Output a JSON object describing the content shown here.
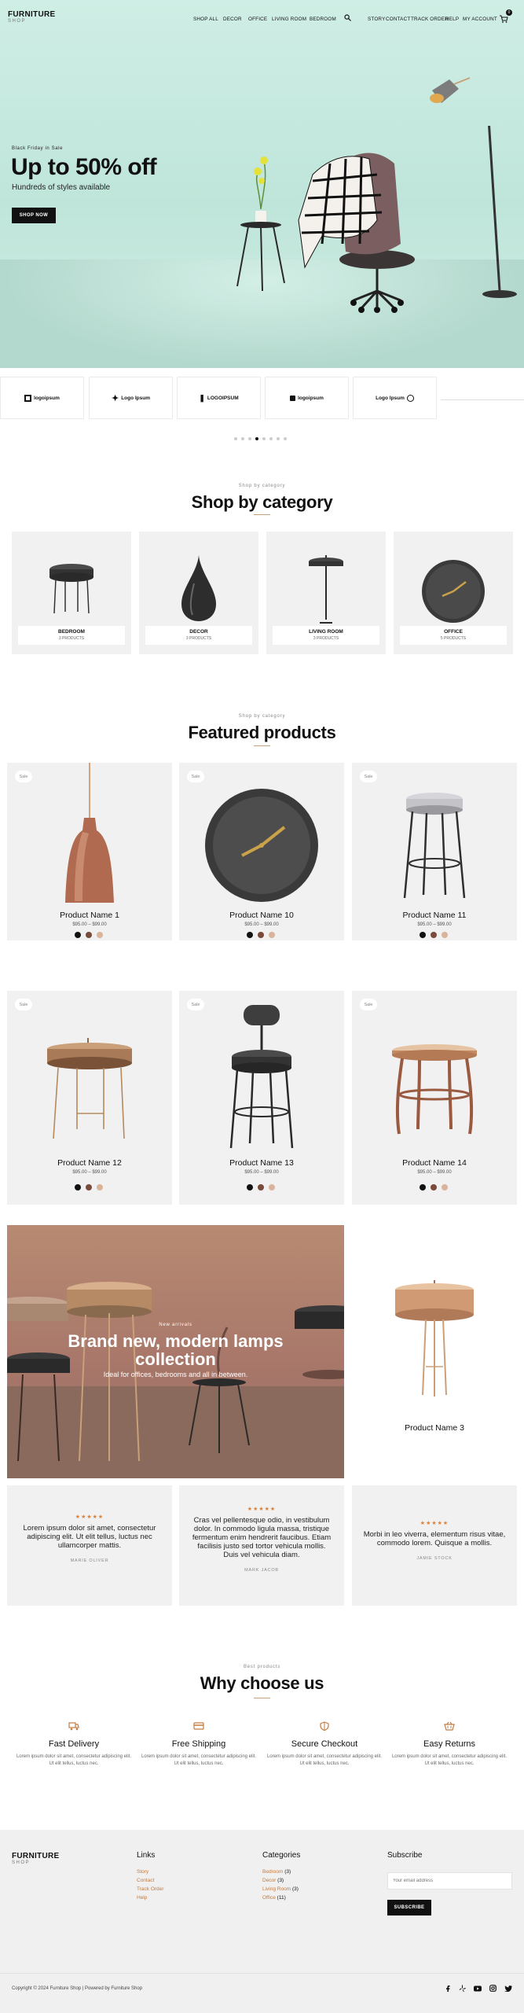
{
  "brand": {
    "name": "FURNITURE",
    "sub": "SHOP"
  },
  "nav": {
    "items": [
      "SHOP ALL",
      "DECOR",
      "OFFICE",
      "LIVING ROOM",
      "BEDROOM"
    ],
    "right_items": [
      "STORY",
      "CONTACT",
      "TRACK ORDER",
      "HELP",
      "MY ACCOUNT"
    ],
    "cart_count": "0"
  },
  "hero": {
    "eyebrow": "Black Friday in Sale",
    "title": "Up to 50% off",
    "subtitle": "Hundreds of styles available",
    "cta": "SHOP NOW"
  },
  "brands": [
    "logoipsum",
    "Logo Ipsum",
    "LOGOIPSUM",
    "logoipsum",
    "Logo Ipsum"
  ],
  "carousel": {
    "dots": 8,
    "active": 3
  },
  "categories": {
    "eyebrow": "Shop by category",
    "title": "Shop by category",
    "items": [
      {
        "name": "BEDROOM",
        "count": "3 PRODUCTS"
      },
      {
        "name": "DECOR",
        "count": "3 PRODUCTS"
      },
      {
        "name": "LIVING ROOM",
        "count": "3 PRODUCTS"
      },
      {
        "name": "OFFICE",
        "count": "5 PRODUCTS"
      }
    ]
  },
  "featured": {
    "eyebrow": "Shop by category",
    "title": "Featured products",
    "sale_label": "Sale",
    "price": "$95.00 – $99.00",
    "products": [
      {
        "name": "Product Name 1"
      },
      {
        "name": "Product Name 10"
      },
      {
        "name": "Product Name 11"
      },
      {
        "name": "Product Name 12"
      },
      {
        "name": "Product Name 13"
      },
      {
        "name": "Product Name 14"
      }
    ],
    "swatches": [
      "#111111",
      "#7a4a3a",
      "#d9b49a"
    ]
  },
  "promo": {
    "eyebrow": "New arrivals",
    "title_line1": "Brand new, modern lamps",
    "title_line2": "collection",
    "subtitle": "Ideal for offices, bedrooms and all in between.",
    "side_product": "Product Name 3"
  },
  "testimonials": [
    {
      "stars": "★★★★★",
      "text": "Lorem ipsum dolor sit amet, consectetur adipiscing elit. Ut elit tellus, luctus nec ullamcorper mattis.",
      "author": "MARIE OLIVER"
    },
    {
      "stars": "★★★★★",
      "text": "Cras vel pellentesque odio, in vestibulum dolor. In commodo ligula massa, tristique fermentum enim hendrerit faucibus. Etiam facilisis justo sed tortor vehicula mollis. Duis vel vehicula diam.",
      "author": "MARK JACOB"
    },
    {
      "stars": "★★★★★",
      "text": "Morbi in leo viverra, elementum risus vitae, commodo lorem. Quisque a mollis.",
      "author": "JAMIE STOCK"
    }
  ],
  "why": {
    "eyebrow": "Best products",
    "title": "Why choose us",
    "items": [
      {
        "title": "Fast Delivery",
        "text": "Lorem ipsum dolor sit amet, consectetur adipiscing elit. Ut elit tellus, luctus nec.",
        "icon": "truck-icon"
      },
      {
        "title": "Free Shipping",
        "text": "Lorem ipsum dolor sit amet, consectetur adipiscing elit. Ut elit tellus, luctus nec.",
        "icon": "card-icon"
      },
      {
        "title": "Secure Checkout",
        "text": "Lorem ipsum dolor sit amet, consectetur adipiscing elit. Ut elit tellus, luctus nec.",
        "icon": "shield-icon"
      },
      {
        "title": "Easy Returns",
        "text": "Lorem ipsum dolor sit amet, consectetur adipiscing elit. Ut elit tellus, luctus nec.",
        "icon": "basket-icon"
      }
    ]
  },
  "footer": {
    "links_title": "Links",
    "links": [
      "Story",
      "Contact",
      "Track Order",
      "Help"
    ],
    "categories_title": "Categories",
    "categories": [
      {
        "name": "Bedroom",
        "count": "(3)"
      },
      {
        "name": "Decor",
        "count": "(3)"
      },
      {
        "name": "Living Room",
        "count": "(3)"
      },
      {
        "name": "Office",
        "count": "(11)"
      }
    ],
    "subscribe_title": "Subscribe",
    "email_placeholder": "Your email address",
    "subscribe_button": "SUBSCRIBE",
    "copyright": "Copyright © 2024 Furniture Shop | Powered by Furniture Shop"
  },
  "colors": {
    "accent": "#c47c40",
    "dark": "#111111",
    "card": "#f1f1f1",
    "hero_bg": "#c6e8de"
  }
}
